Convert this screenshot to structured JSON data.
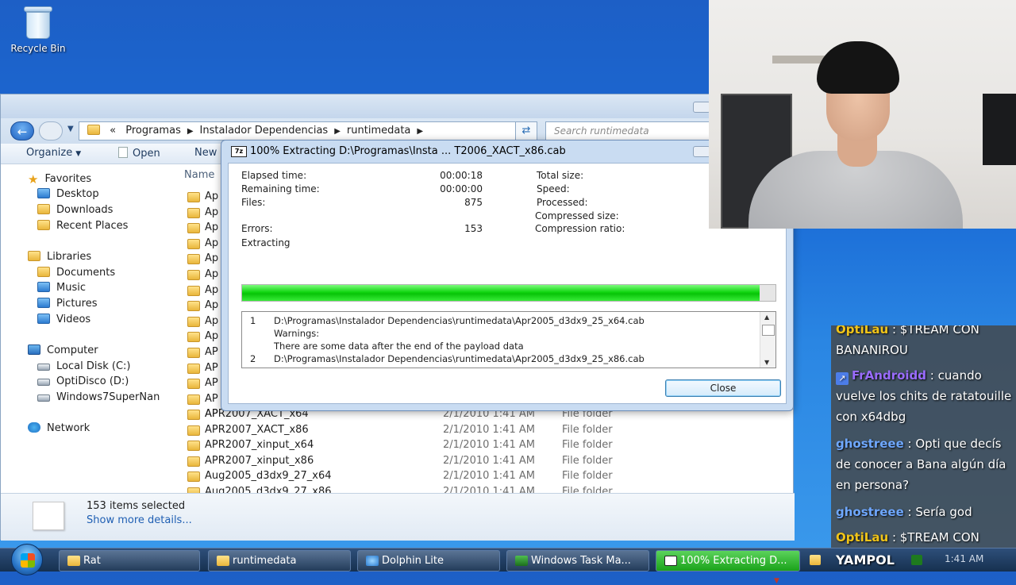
{
  "desktop": {
    "recycle_bin": "Recycle Bin"
  },
  "explorer": {
    "breadcrumb": [
      "«",
      "Programas",
      "Instalador Dependencias",
      "runtimedata"
    ],
    "search_placeholder": "Search runtimedata",
    "commands": {
      "organize": "Organize",
      "open": "Open",
      "new_folder": "New"
    },
    "column_name": "Name",
    "nav": {
      "favorites": "Favorites",
      "desktop": "Desktop",
      "downloads": "Downloads",
      "recent": "Recent Places",
      "libraries": "Libraries",
      "documents": "Documents",
      "music": "Music",
      "pictures": "Pictures",
      "videos": "Videos",
      "computer": "Computer",
      "local_disk": "Local Disk (C:)",
      "optidisco": "OptiDisco (D:)",
      "win7": "Windows7SuperNan",
      "network": "Network"
    },
    "hidden_rows_prefix": [
      "Ap",
      "Ap",
      "Ap",
      "Ap",
      "Ap",
      "Ap",
      "Ap",
      "Ap",
      "Ap",
      "Ap",
      "AP",
      "AP",
      "AP",
      "AP",
      "AP"
    ],
    "rows": [
      {
        "name": "APR2007_XACT_x64",
        "date": "2/1/2010 1:41 AM",
        "type": "File folder"
      },
      {
        "name": "APR2007_XACT_x86",
        "date": "2/1/2010 1:41 AM",
        "type": "File folder"
      },
      {
        "name": "APR2007_xinput_x64",
        "date": "2/1/2010 1:41 AM",
        "type": "File folder"
      },
      {
        "name": "APR2007_xinput_x86",
        "date": "2/1/2010 1:41 AM",
        "type": "File folder"
      },
      {
        "name": "Aug2005_d3dx9_27_x64",
        "date": "2/1/2010 1:41 AM",
        "type": "File folder"
      },
      {
        "name": "Aug2005_d3dx9_27_x86",
        "date": "2/1/2010 1:41 AM",
        "type": "File folder"
      }
    ],
    "details": {
      "selected": "153 items selected",
      "more": "Show more details..."
    }
  },
  "dialog": {
    "title": "100% Extracting D:\\Programas\\Insta ... T2006_XACT_x86.cab",
    "elapsed_label": "Elapsed time:",
    "elapsed": "00:00:18",
    "remaining_label": "Remaining time:",
    "remaining": "00:00:00",
    "files_label": "Files:",
    "files": "875",
    "errors_label": "Errors:",
    "errors": "153",
    "status": "Extracting",
    "total_size_label": "Total size:",
    "speed_label": "Speed:",
    "processed_label": "Processed:",
    "compressed_label": "Compressed size:",
    "ratio_label": "Compression ratio:",
    "progress": 0.97,
    "messages": [
      {
        "num": "1",
        "text": "D:\\Programas\\Instalador Dependencias\\runtimedata\\Apr2005_d3dx9_25_x64.cab"
      },
      {
        "num": "",
        "text": "Warnings:"
      },
      {
        "num": "",
        "text": "There are some data after the end of the payload data"
      },
      {
        "num": "2",
        "text": "D:\\Programas\\Instalador Dependencias\\runtimedata\\Apr2005_d3dx9_25_x86.cab"
      }
    ],
    "close": "Close"
  },
  "chat": [
    {
      "user": "OptiLau",
      "color": "#f0c419",
      "text": " : $TREAM CON BANANIROU",
      "badge": false
    },
    {
      "user": "FrAndroidd",
      "color": "#9a6cff",
      "text": " : cuando vuelve los chits de ratatouille con x64dbg",
      "badge": true
    },
    {
      "user": "ghostreee",
      "color": "#6fa8ff",
      "text": " : Opti que decís de conocer a Bana algún día en persona?",
      "badge": false
    },
    {
      "user": "ghostreee",
      "color": "#6fa8ff",
      "text": " : Sería god",
      "badge": false
    },
    {
      "user": "OptiLau",
      "color": "#f0c419",
      "text": " : $TREAM CON",
      "badge": false
    }
  ],
  "overlay_name": "YAMPOL",
  "taskbar": {
    "items": [
      {
        "label": "Rat"
      },
      {
        "label": "runtimedata"
      },
      {
        "label": "Dolphin Lite"
      },
      {
        "label": "Windows Task Ma..."
      },
      {
        "label": "100% Extracting D..."
      }
    ],
    "clock": "1:41 AM"
  }
}
